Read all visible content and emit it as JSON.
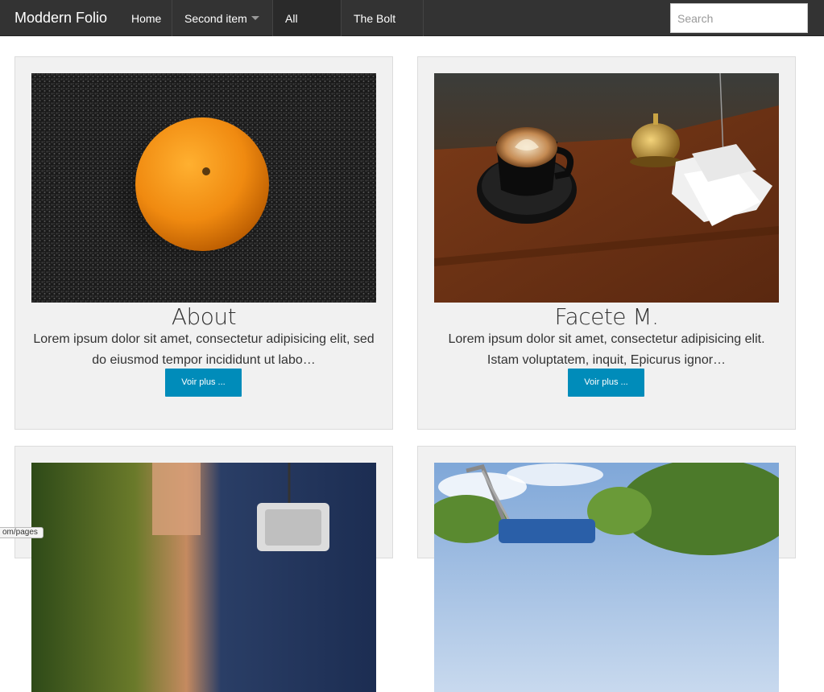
{
  "navbar": {
    "brand": "Moddern Folio",
    "items": [
      {
        "label": "Home"
      },
      {
        "label": "Second item"
      },
      {
        "label": "All pages"
      },
      {
        "label": "The Bolt site"
      }
    ],
    "search_placeholder": "Search"
  },
  "cards": [
    {
      "title": "About",
      "text": "Lorem ipsum dolor sit amet, consectetur adipisicing elit, sed do eiusmod tempor incididunt ut labo…",
      "button": "Voir plus ...",
      "image": "orange-on-black-sand"
    },
    {
      "title": "Facete M.",
      "text": "Lorem ipsum dolor sit amet, consectetur adipisicing elit. Istam voluptatem, inquit, Epicurus ignor…",
      "button": "Voir plus ...",
      "image": "coffee-cup-on-wooden-counter"
    },
    {
      "image": "person-with-camera-outdoors"
    },
    {
      "image": "lawn-mower-under-trees"
    }
  ],
  "status_bar": {
    "url": "om/pages"
  }
}
